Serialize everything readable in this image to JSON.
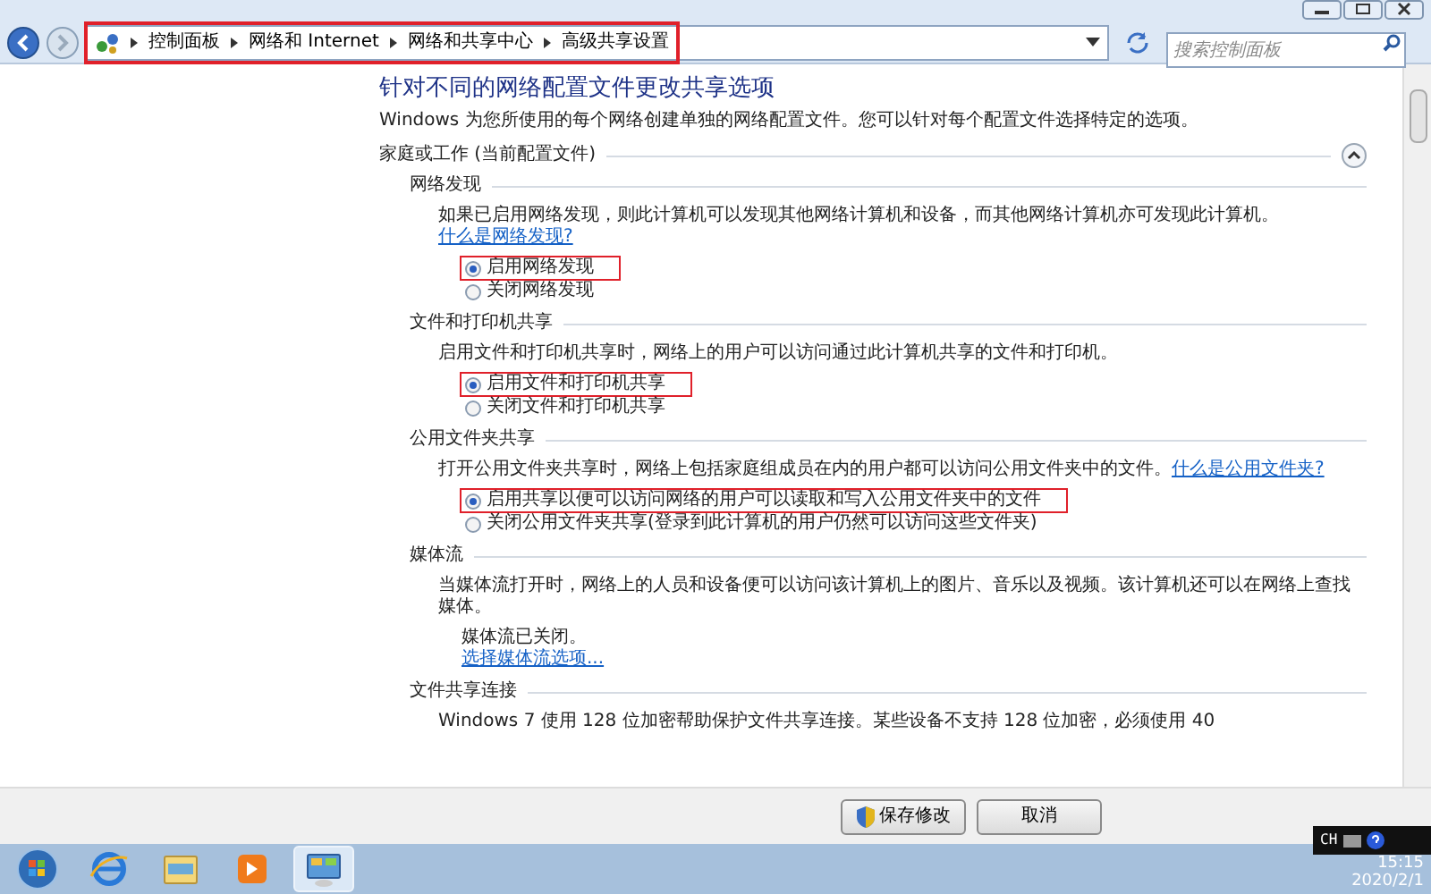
{
  "address_bar": {
    "breadcrumbs": [
      "控制面板",
      "网络和 Internet",
      "网络和共享中心",
      "高级共享设置"
    ],
    "highlighted": true
  },
  "search": {
    "placeholder": "搜索控制面板"
  },
  "page": {
    "title": "针对不同的网络配置文件更改共享选项",
    "description": "Windows 为您所使用的每个网络创建单独的网络配置文件。您可以针对每个配置文件选择特定的选项。",
    "profile": {
      "label": "家庭或工作 (当前配置文件)",
      "expanded": true
    },
    "sections": [
      {
        "heading": "网络发现",
        "description": "如果已启用网络发现，则此计算机可以发现其他网络计算机和设备，而其他网络计算机亦可发现此计算机。",
        "link": "什么是网络发现?",
        "options": [
          {
            "label": "启用网络发现",
            "selected": true,
            "highlighted": true
          },
          {
            "label": "关闭网络发现",
            "selected": false,
            "highlighted": false
          }
        ]
      },
      {
        "heading": "文件和打印机共享",
        "description": "启用文件和打印机共享时，网络上的用户可以访问通过此计算机共享的文件和打印机。",
        "options": [
          {
            "label": "启用文件和打印机共享",
            "selected": true,
            "highlighted": true
          },
          {
            "label": "关闭文件和打印机共享",
            "selected": false,
            "highlighted": false
          }
        ]
      },
      {
        "heading": "公用文件夹共享",
        "description": "打开公用文件夹共享时，网络上包括家庭组成员在内的用户都可以访问公用文件夹中的文件。",
        "link": "什么是公用文件夹?",
        "options": [
          {
            "label": "启用共享以便可以访问网络的用户可以读取和写入公用文件夹中的文件",
            "selected": true,
            "highlighted": true
          },
          {
            "label": "关闭公用文件夹共享(登录到此计算机的用户仍然可以访问这些文件夹)",
            "selected": false,
            "highlighted": false
          }
        ]
      },
      {
        "heading": "媒体流",
        "description": "当媒体流打开时，网络上的人员和设备便可以访问该计算机上的图片、音乐以及视频。该计算机还可以在网络上查找媒体。",
        "status": "媒体流已关闭。",
        "status_link": "选择媒体流选项..."
      },
      {
        "heading": "文件共享连接",
        "description": "Windows 7 使用 128 位加密帮助保护文件共享连接。某些设备不支持 128 位加密，必须使用 40"
      }
    ]
  },
  "buttons": [
    {
      "label": "保存修改",
      "kind": "shield"
    },
    {
      "label": "取消",
      "kind": "plain"
    }
  ],
  "taskbar": {
    "apps": [
      {
        "kind": "start",
        "selected": false
      },
      {
        "kind": "browser",
        "selected": false
      },
      {
        "kind": "folder",
        "selected": false
      },
      {
        "kind": "player",
        "selected": false
      },
      {
        "kind": "control-panel",
        "selected": true
      }
    ]
  },
  "tray": {
    "language": "CH",
    "time": "15:15",
    "date": "2020/2/1"
  }
}
